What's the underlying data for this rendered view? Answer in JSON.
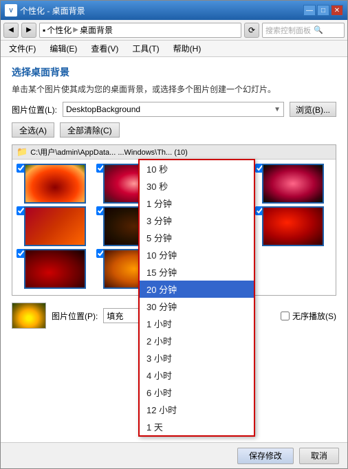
{
  "window": {
    "logo": "V",
    "title_text": "个性化 - 桌面背景",
    "buttons": [
      "—",
      "□",
      "✕"
    ]
  },
  "addressbar": {
    "back": "◀",
    "forward": "▶",
    "breadcrumb_parts": [
      "▪",
      "个性化",
      "▶",
      "桌面背景"
    ],
    "refresh": "⟳",
    "search_placeholder": "搜索控制面板"
  },
  "menubar": {
    "items": [
      "文件(F)",
      "编辑(E)",
      "查看(V)",
      "工具(T)",
      "帮助(H)"
    ]
  },
  "content": {
    "page_title": "选择桌面背景",
    "page_desc": "单击某个图片使其成为您的桌面背景，或选择多个图片创建一个幻灯片。",
    "location_label": "图片位置(L):",
    "location_value": "DesktopBackground",
    "browse_label": "浏览(B)...",
    "select_all": "全选(A)",
    "clear_all": "全部清除(C)",
    "folder_path": "C:\\用户\\admin\\AppData... ...Windows\\Th... (10)",
    "position_label": "图片位置(P):",
    "position_value": "填充",
    "shuffle_label": "无序播放(S)"
  },
  "dropdown": {
    "items": [
      "10 秒",
      "30 秒",
      "1 分钟",
      "3 分钟",
      "5 分钟",
      "10 分钟",
      "15 分钟",
      "20 分钟",
      "30 分钟",
      "1 小时",
      "2 小时",
      "3 小时",
      "4 小时",
      "6 小时",
      "12 小时",
      "1 天"
    ],
    "selected": "20 分钟",
    "current_value": "30 分钟"
  },
  "footer": {
    "save_label": "保存修改",
    "cancel_label": "取消"
  }
}
